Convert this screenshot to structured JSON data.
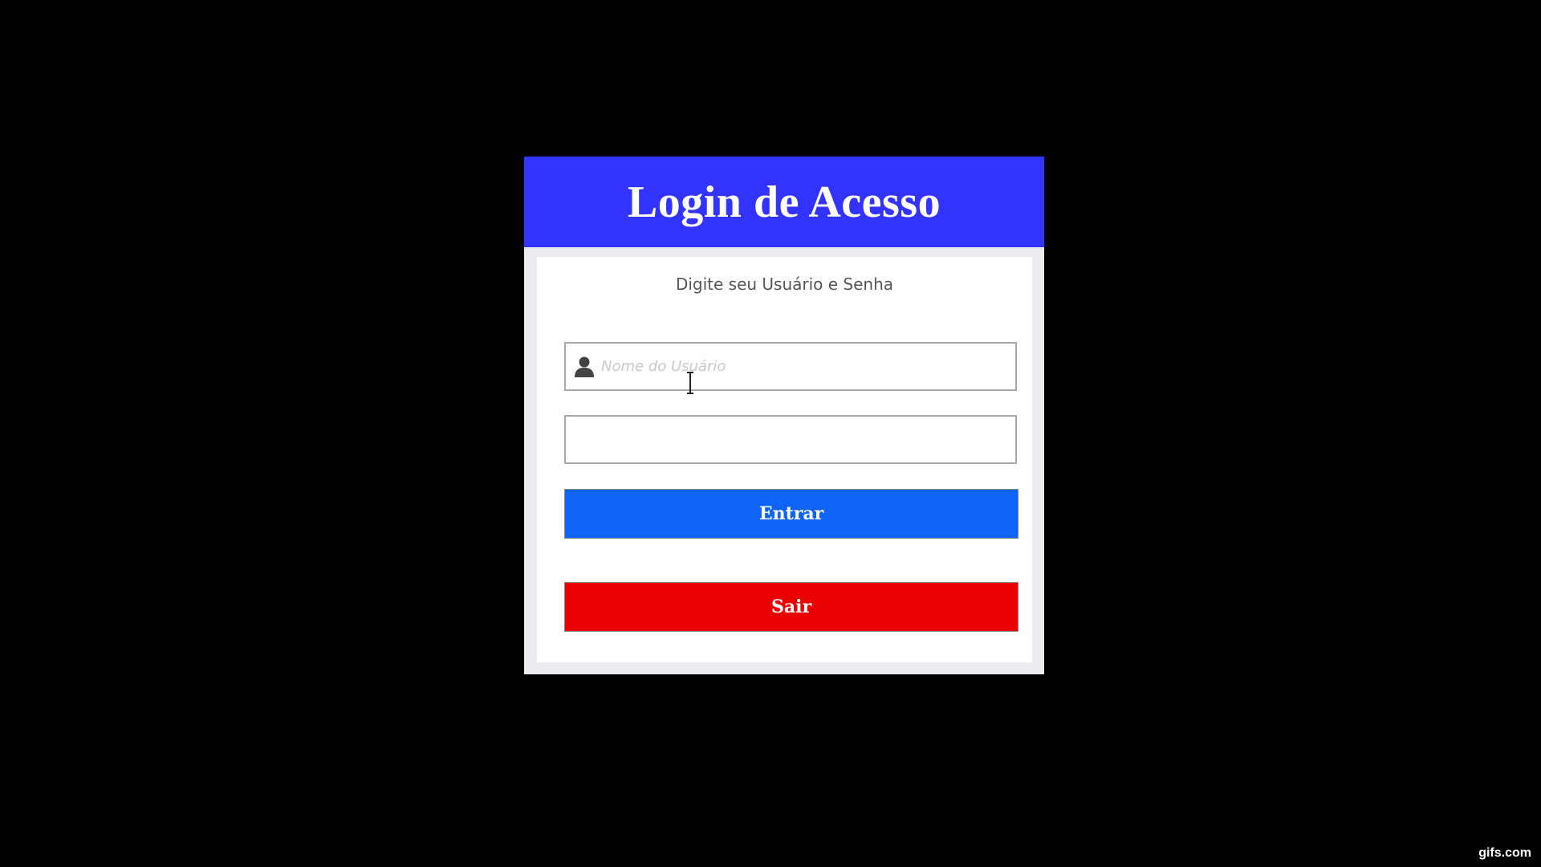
{
  "login": {
    "title": "Login de Acesso",
    "subtitle": "Digite seu Usuário e Senha",
    "username": {
      "value": "",
      "placeholder": "Nome do Usuário",
      "icon": "user-icon"
    },
    "password": {
      "value": "",
      "placeholder": ""
    },
    "enter_label": "Entrar",
    "exit_label": "Sair"
  },
  "colors": {
    "header": "#3333ff",
    "enter_button": "#0e64f4",
    "exit_button": "#ea0000",
    "background": "#000000"
  },
  "watermark": "gifs.com"
}
